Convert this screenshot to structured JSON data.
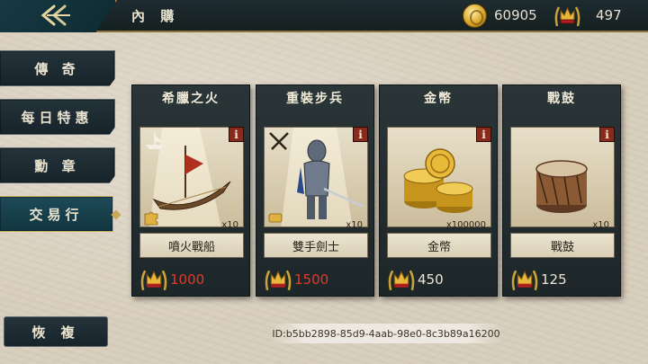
{
  "header": {
    "title": "內 購",
    "gold": "60905",
    "crowns": "497"
  },
  "sidebar": {
    "items": [
      {
        "label": "傳 奇",
        "active": false
      },
      {
        "label": "每日特惠",
        "active": false
      },
      {
        "label": "勳 章",
        "active": false
      },
      {
        "label": "交易行",
        "active": true
      }
    ],
    "restore_label": "恢 複"
  },
  "cards": [
    {
      "title": "希臘之火",
      "name": "噴火戰船",
      "qty": "x10",
      "price": "1000",
      "price_color": "#e23a2a",
      "icon": "ship-icon",
      "category_icon": "puzzle-piece-icon"
    },
    {
      "title": "重裝步兵",
      "name": "雙手劍士",
      "qty": "x10",
      "price": "1500",
      "price_color": "#e23a2a",
      "icon": "knight-icon",
      "category_icon": "crossed-swords-icon"
    },
    {
      "title": "金幣",
      "name": "金幣",
      "qty": "x100000",
      "price": "450",
      "price_color": "#ece6d6",
      "icon": "gold-coins-icon"
    },
    {
      "title": "戰鼓",
      "name": "戰鼓",
      "qty": "x10",
      "price": "125",
      "price_color": "#ece6d6",
      "icon": "war-drum-icon"
    }
  ],
  "footer": {
    "id_text": "ID:b5bb2898-85d9-4aab-98e0-8c3b89a16200"
  },
  "colors": {
    "topbar": "#1e2b30",
    "accent_gold": "#d1b162",
    "price_red": "#e23a2a"
  }
}
